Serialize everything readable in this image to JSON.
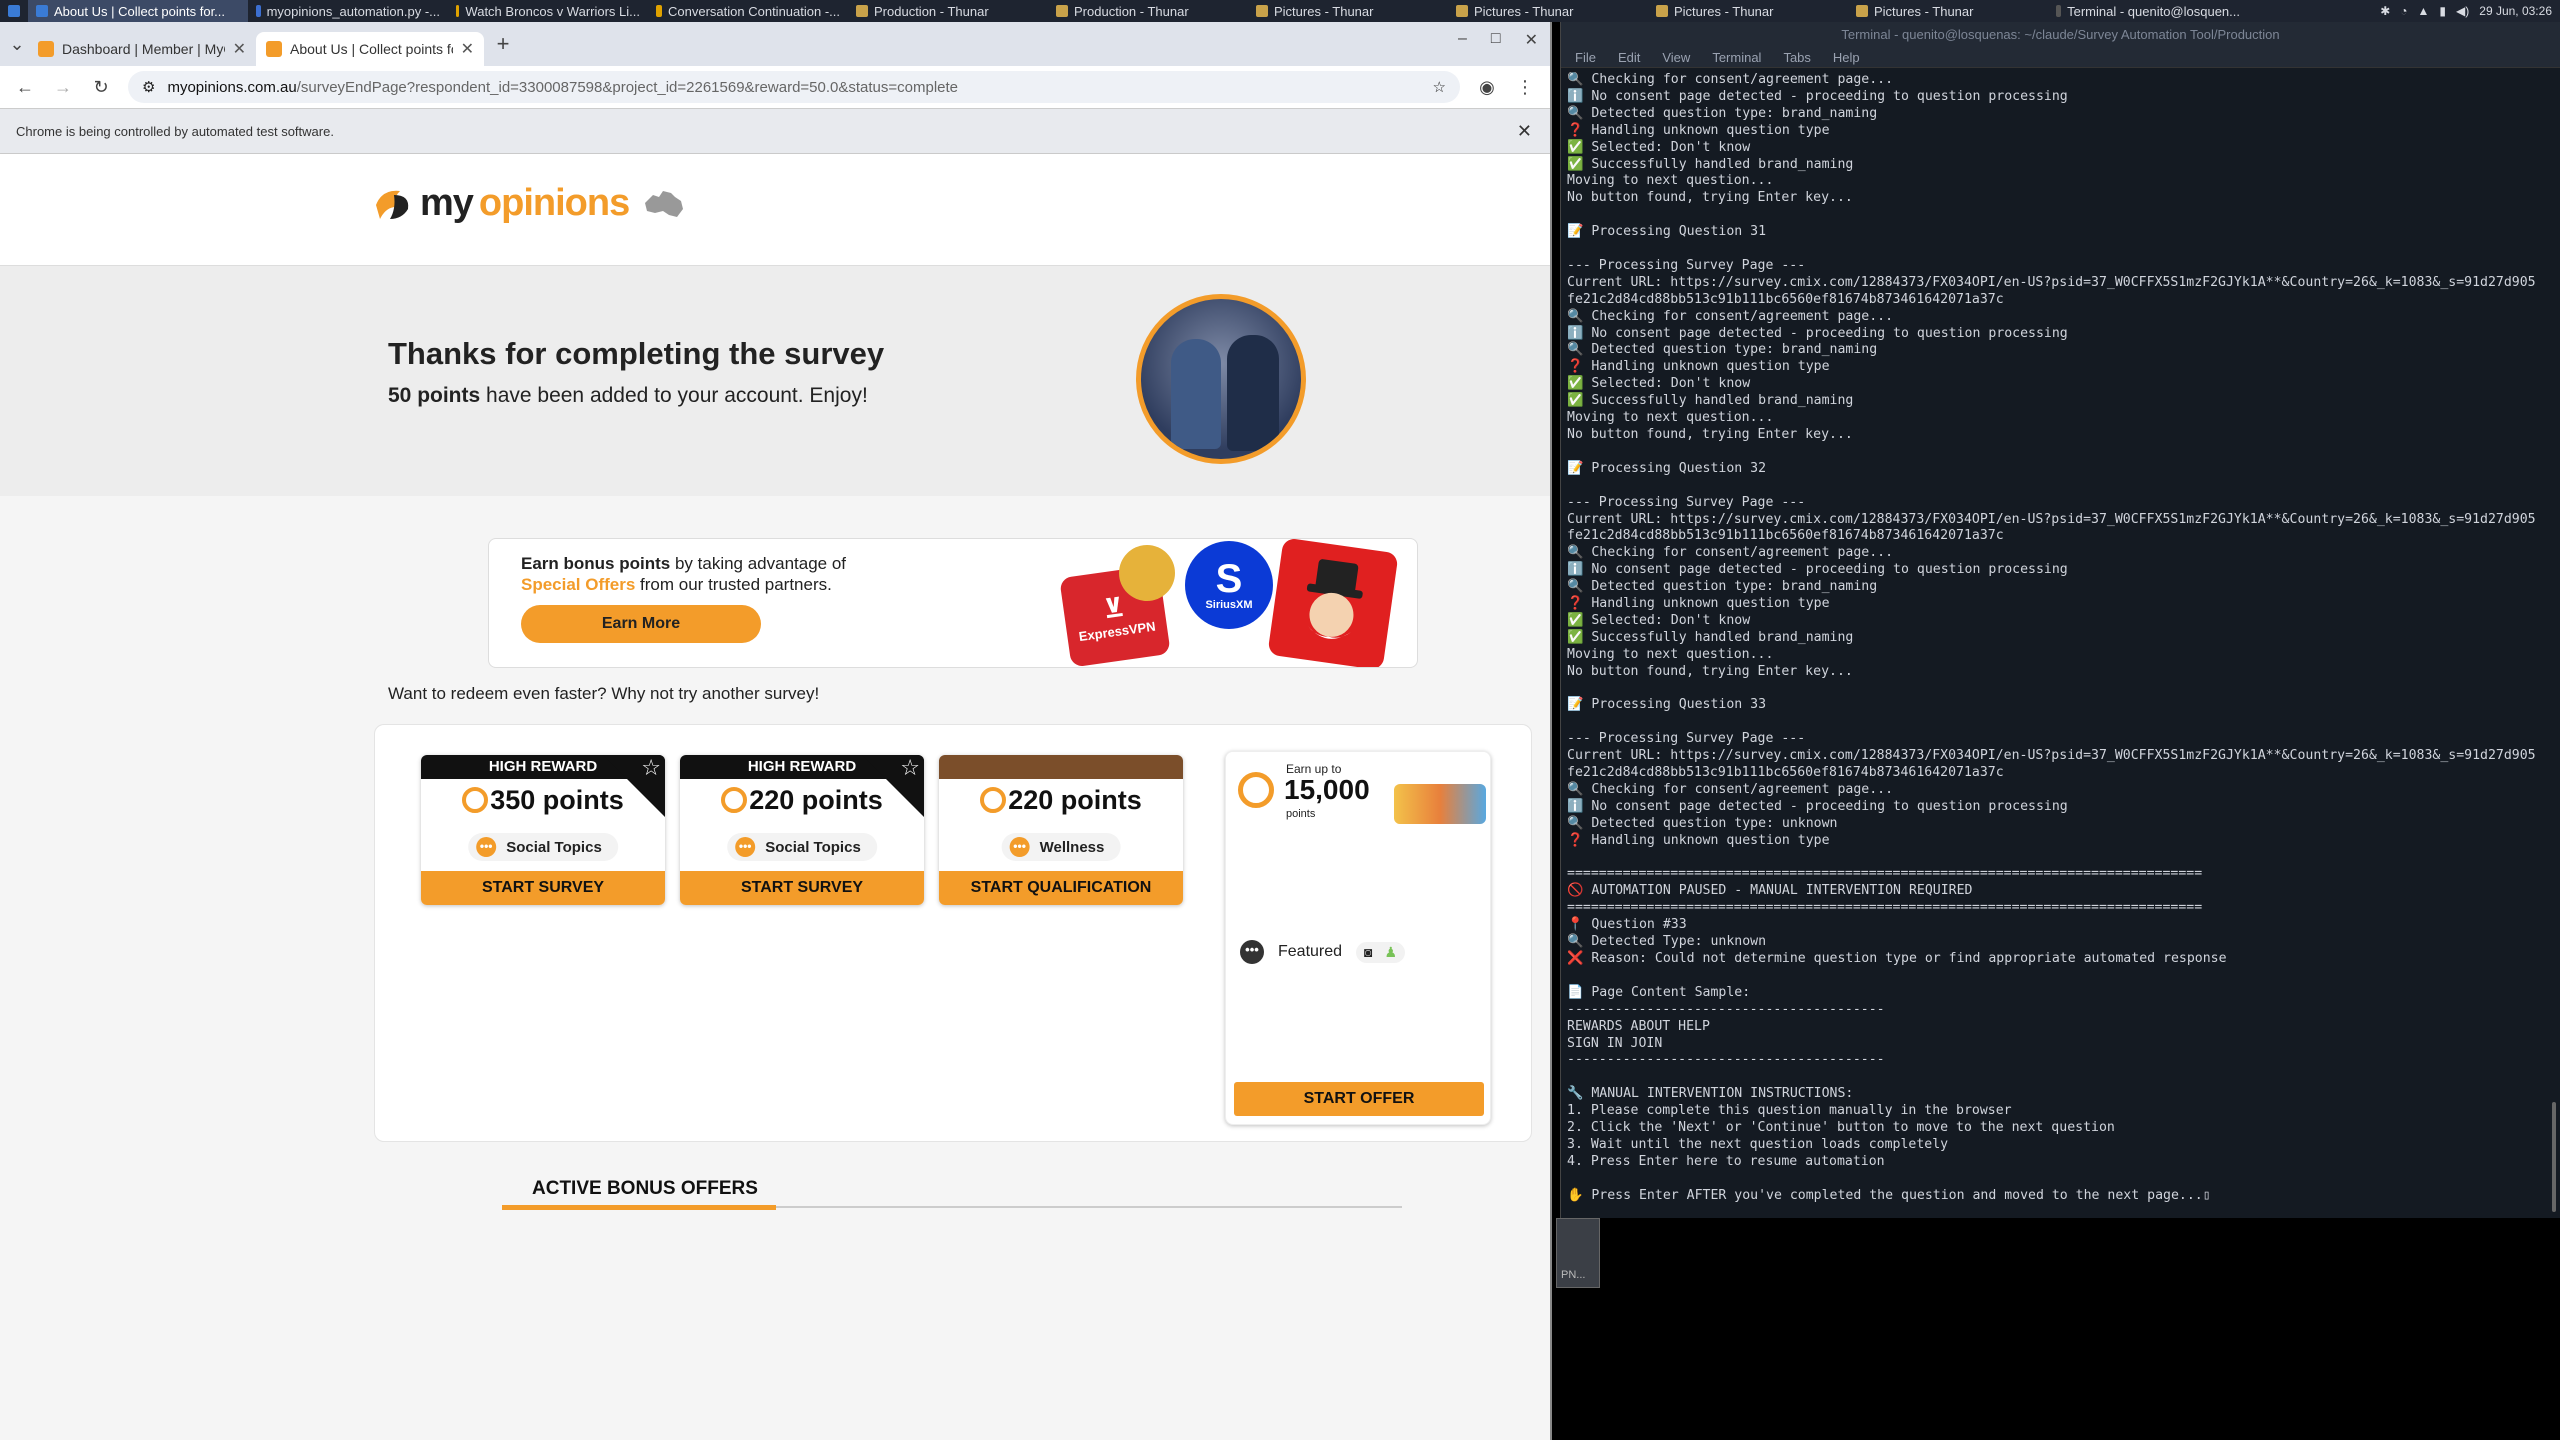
{
  "taskbar": {
    "items": [
      {
        "label": "About Us | Collect points for...",
        "active": true
      },
      {
        "label": "myopinions_automation.py -...",
        "active": false
      },
      {
        "label": "Watch Broncos v Warriors Li...",
        "active": false
      },
      {
        "label": "Conversation Continuation -...",
        "active": false
      },
      {
        "label": "Production - Thunar",
        "active": false
      },
      {
        "label": "Production - Thunar",
        "active": false
      },
      {
        "label": "Pictures - Thunar",
        "active": false
      },
      {
        "label": "Pictures - Thunar",
        "active": false
      },
      {
        "label": "Pictures - Thunar",
        "active": false
      },
      {
        "label": "Pictures - Thunar",
        "active": false
      },
      {
        "label": "Terminal - quenito@losquen...",
        "active": false
      }
    ],
    "clock": "29 Jun, 03:26"
  },
  "browser": {
    "tabs": [
      {
        "title": "Dashboard | Member | MyOp",
        "active": false
      },
      {
        "title": "About Us | Collect points for",
        "active": true
      }
    ],
    "new_tab": "+",
    "url_host": "myopinions.com.au",
    "url_path": "/surveyEndPage?respondent_id=3300087598&project_id=2261569&reward=50.0&status=complete",
    "infobar_text": "Chrome is being controlled by automated test software."
  },
  "site": {
    "logo_my": "my",
    "logo_opinions": "opinions",
    "thanks_title": "Thanks for completing the survey",
    "points_bold": "50 points",
    "points_rest": " have been added to your account. Enjoy!",
    "bonus_bold": "Earn bonus points",
    "bonus_text1": " by taking advantage of",
    "bonus_orange": "Special Offers",
    "bonus_text2": " from our trusted partners.",
    "earn_more": "Earn More",
    "promo_labels": [
      "ExpressVPN",
      "SiriusXM"
    ],
    "redeem_text": "Want to redeem even faster? Why not try another survey!",
    "cards": [
      {
        "badge": "HIGH REWARD",
        "points": "350 points",
        "topic": "Social Topics",
        "button": "START SURVEY",
        "high": true
      },
      {
        "badge": "HIGH REWARD",
        "points": "220 points",
        "topic": "Social Topics",
        "button": "START SURVEY",
        "high": true
      },
      {
        "badge": "",
        "points": "220 points",
        "topic": "Wellness",
        "button": "START QUALIFICATION",
        "high": false
      }
    ],
    "offer": {
      "earn_up_to": "Earn up to",
      "amount": "15,000",
      "unit": "points",
      "featured": "Featured",
      "button": "START OFFER"
    },
    "active_bonus": "ACTIVE BONUS OFFERS"
  },
  "terminal": {
    "title": "Terminal - quenito@losquenas: ~/claude/Survey Automation Tool/Production",
    "menu": [
      "File",
      "Edit",
      "View",
      "Terminal",
      "Tabs",
      "Help"
    ],
    "lines": [
      "🔍 Checking for consent/agreement page...",
      "ℹ️ No consent page detected - proceeding to question processing",
      "🔍 Detected question type: brand_naming",
      "❓ Handling unknown question type",
      "✅ Selected: Don't know",
      "✅ Successfully handled brand_naming",
      "Moving to next question...",
      "No button found, trying Enter key...",
      "",
      "📝 Processing Question 31",
      "",
      "--- Processing Survey Page ---",
      "Current URL: https://survey.cmix.com/12884373/FX034OPI/en-US?psid=37_W0CFFX5S1mzF2GJYk1A**&Country=26&_k=1083&_s=91d27d905",
      "fe21c2d84cd88bb513c91b111bc6560ef81674b873461642071a37c",
      "🔍 Checking for consent/agreement page...",
      "ℹ️ No consent page detected - proceeding to question processing",
      "🔍 Detected question type: brand_naming",
      "❓ Handling unknown question type",
      "✅ Selected: Don't know",
      "✅ Successfully handled brand_naming",
      "Moving to next question...",
      "No button found, trying Enter key...",
      "",
      "📝 Processing Question 32",
      "",
      "--- Processing Survey Page ---",
      "Current URL: https://survey.cmix.com/12884373/FX034OPI/en-US?psid=37_W0CFFX5S1mzF2GJYk1A**&Country=26&_k=1083&_s=91d27d905",
      "fe21c2d84cd88bb513c91b111bc6560ef81674b873461642071a37c",
      "🔍 Checking for consent/agreement page...",
      "ℹ️ No consent page detected - proceeding to question processing",
      "🔍 Detected question type: brand_naming",
      "❓ Handling unknown question type",
      "✅ Selected: Don't know",
      "✅ Successfully handled brand_naming",
      "Moving to next question...",
      "No button found, trying Enter key...",
      "",
      "📝 Processing Question 33",
      "",
      "--- Processing Survey Page ---",
      "Current URL: https://survey.cmix.com/12884373/FX034OPI/en-US?psid=37_W0CFFX5S1mzF2GJYk1A**&Country=26&_k=1083&_s=91d27d905",
      "fe21c2d84cd88bb513c91b111bc6560ef81674b873461642071a37c",
      "🔍 Checking for consent/agreement page...",
      "ℹ️ No consent page detected - proceeding to question processing",
      "🔍 Detected question type: unknown",
      "❓ Handling unknown question type",
      "",
      "================================================================================",
      "🚫 AUTOMATION PAUSED - MANUAL INTERVENTION REQUIRED",
      "================================================================================",
      "📍 Question #33",
      "🔍 Detected Type: unknown",
      "❌ Reason: Could not determine question type or find appropriate automated response",
      "",
      "📄 Page Content Sample:",
      "----------------------------------------",
      "REWARDS ABOUT HELP",
      "SIGN IN JOIN",
      "----------------------------------------",
      "",
      "🔧 MANUAL INTERVENTION INSTRUCTIONS:",
      "1. Please complete this question manually in the browser",
      "2. Click the 'Next' or 'Continue' button to move to the next question",
      "3. Wait until the next question loads completely",
      "4. Press Enter here to resume automation",
      "",
      "✋ Press Enter AFTER you've completed the question and moved to the next page...▯"
    ]
  },
  "thunar_stub": "PN..."
}
